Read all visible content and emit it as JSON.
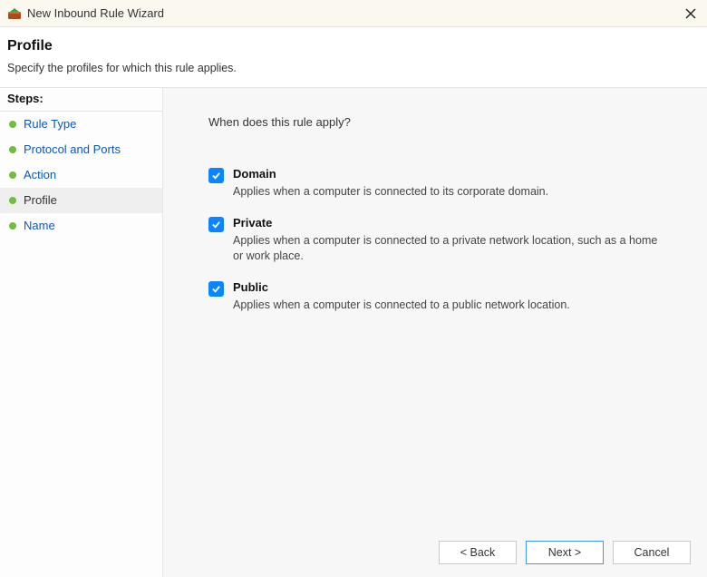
{
  "window": {
    "title": "New Inbound Rule Wizard"
  },
  "header": {
    "title": "Profile",
    "subtitle": "Specify the profiles for which this rule applies."
  },
  "sidebar": {
    "heading": "Steps:",
    "items": [
      {
        "label": "Rule Type",
        "active": false
      },
      {
        "label": "Protocol and Ports",
        "active": false
      },
      {
        "label": "Action",
        "active": false
      },
      {
        "label": "Profile",
        "active": true
      },
      {
        "label": "Name",
        "active": false
      }
    ]
  },
  "main": {
    "question": "When does this rule apply?",
    "options": [
      {
        "title": "Domain",
        "description": "Applies when a computer is connected to its corporate domain.",
        "checked": true
      },
      {
        "title": "Private",
        "description": "Applies when a computer is connected to a private network location, such as a home or work place.",
        "checked": true
      },
      {
        "title": "Public",
        "description": "Applies when a computer is connected to a public network location.",
        "checked": true
      }
    ]
  },
  "buttons": {
    "back": "< Back",
    "next": "Next >",
    "cancel": "Cancel"
  },
  "colors": {
    "accent": "#0a84ff",
    "link": "#0a56c2",
    "bullet": "#6fbf3c",
    "titlebar": "#fbf8f0"
  }
}
